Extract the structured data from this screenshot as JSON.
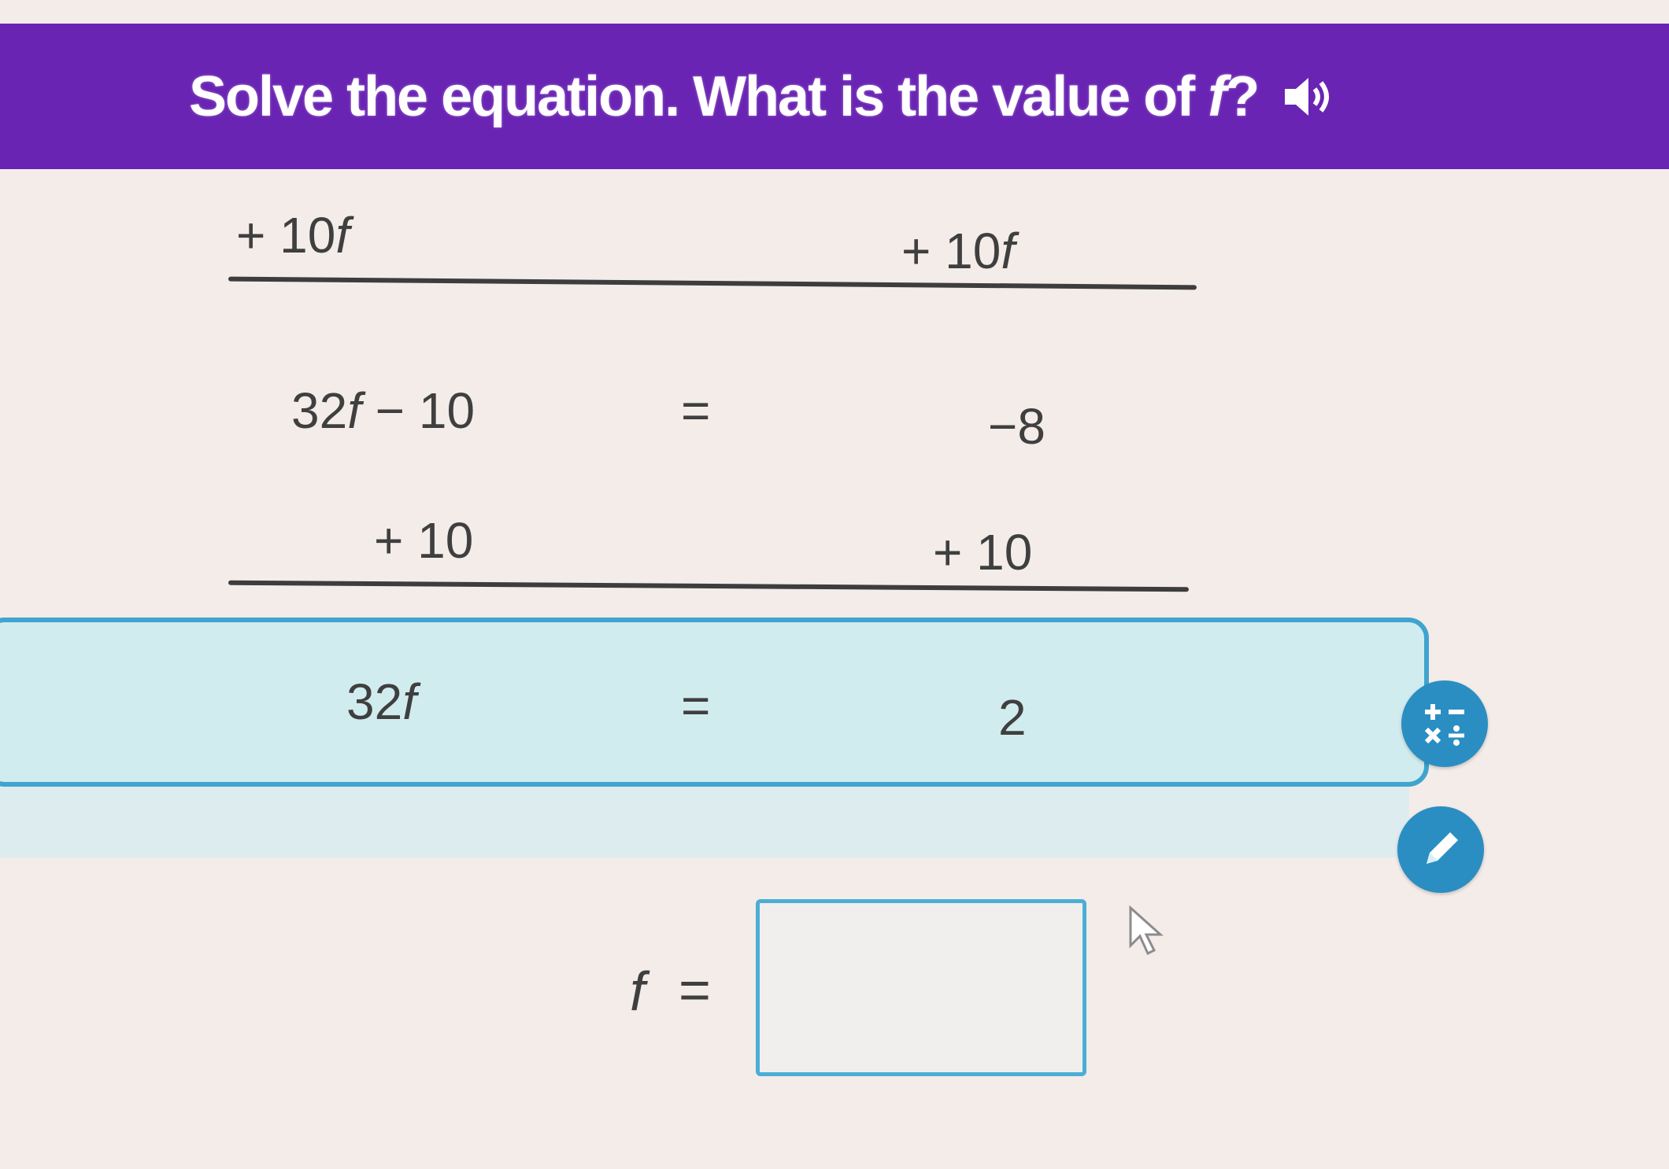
{
  "prompt": {
    "text_before": "Solve the equation. What is the value of ",
    "variable": "f",
    "text_after": "?",
    "audio_icon": "speaker-icon"
  },
  "steps": {
    "row1_left": "+ 10",
    "row1_left_var": "f",
    "row1_right": "+ 10",
    "row1_right_var": "f",
    "row2_left": "32",
    "row2_left_var": "f",
    "row2_left_rest": " − 10",
    "row2_equals": "=",
    "row2_right": "−8",
    "row3_left": "+ 10",
    "row3_right": "+ 10"
  },
  "result": {
    "left": "32",
    "left_var": "f",
    "equals": "=",
    "right": "2"
  },
  "answer": {
    "variable": "f",
    "equals": "=",
    "value": ""
  },
  "icons": {
    "operations": "operations-icon",
    "edit": "pencil-icon"
  },
  "colors": {
    "banner": "#6a24b3",
    "highlight": "#d1ecee",
    "highlight_border": "#3fa4cf",
    "button": "#2a8ec2"
  }
}
